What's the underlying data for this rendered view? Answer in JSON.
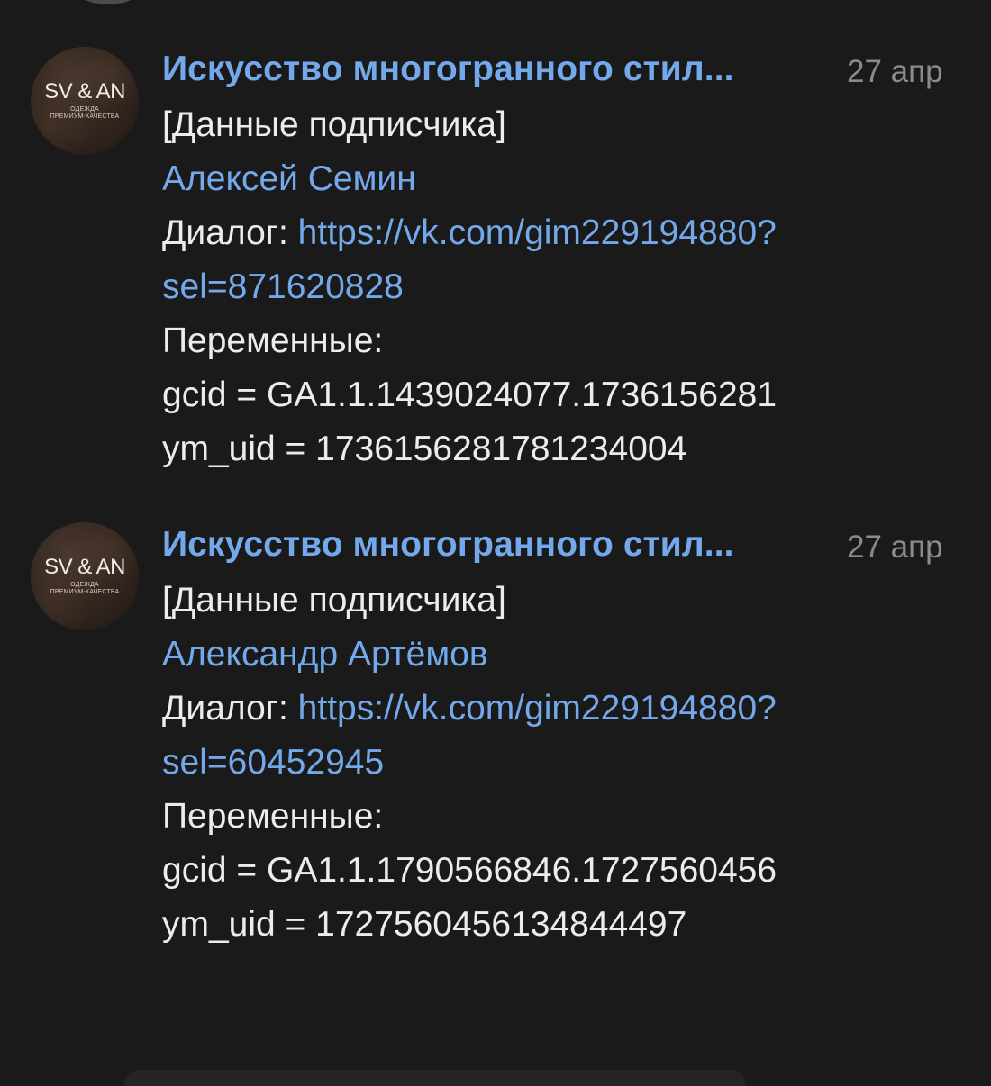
{
  "messages": [
    {
      "avatar": {
        "logo_text": "SV & AN",
        "subtitle": "ОДЕЖДА\nПРЕМИУМ-КАЧЕСТВА"
      },
      "channel_title": "Искусство многогранного стил...",
      "timestamp": "27 апр",
      "header": "[Данные подписчика]",
      "subscriber_name": "Алексей Семин",
      "dialog_label": "Диалог: ",
      "dialog_url_line_1": "https://vk.com/gim229194880?",
      "dialog_url_line_2": "sel=871620828",
      "variables_label": "Переменные:",
      "gcid": "gcid = GA1.1.1439024077.1736156281",
      "ym_uid": "ym_uid = 1736156281781234004"
    },
    {
      "avatar": {
        "logo_text": "SV & AN",
        "subtitle": "ОДЕЖДА\nПРЕМИУМ-КАЧЕСТВА"
      },
      "channel_title": "Искусство многогранного стил...",
      "timestamp": "27 апр",
      "header": "[Данные подписчика]",
      "subscriber_name": "Александр Артёмов",
      "dialog_label": "Диалог: ",
      "dialog_url_line_1": "https://vk.com/gim229194880?",
      "dialog_url_line_2": "sel=60452945",
      "variables_label": "Переменные:",
      "gcid": "gcid = GA1.1.1790566846.1727560456",
      "ym_uid": "ym_uid = 1727560456134844497"
    }
  ],
  "colors": {
    "background": "#1a1a1a",
    "primary_text": "#e9e9e9",
    "accent_blue": "#73a8ea",
    "timestamp": "#8b8b8b",
    "avatar_brown": "#34271f"
  }
}
